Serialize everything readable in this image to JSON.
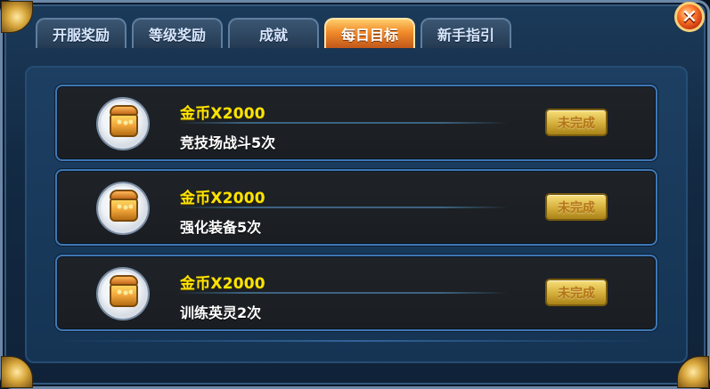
{
  "tabs": [
    {
      "label": "开服奖励",
      "active": false
    },
    {
      "label": "等级奖励",
      "active": false
    },
    {
      "label": "成就",
      "active": false
    },
    {
      "label": "每日目标",
      "active": true
    },
    {
      "label": "新手指引",
      "active": false
    }
  ],
  "close_button": {
    "label": "✕"
  },
  "daily_goals": [
    {
      "icon": "treasure-chest-icon",
      "reward": "金币X2000",
      "task": "竞技场战斗5次",
      "status": "未完成"
    },
    {
      "icon": "treasure-chest-icon",
      "reward": "金币X2000",
      "task": "强化装备5次",
      "status": "未完成"
    },
    {
      "icon": "treasure-chest-icon",
      "reward": "金币X2000",
      "task": "训练英灵2次",
      "status": "未完成"
    }
  ],
  "colors": {
    "accent_tab": "#f08a2a",
    "reward_text": "#ffe400",
    "status_button": "#d4ae3b",
    "panel": "#153454",
    "row_border": "#3e77b4"
  }
}
